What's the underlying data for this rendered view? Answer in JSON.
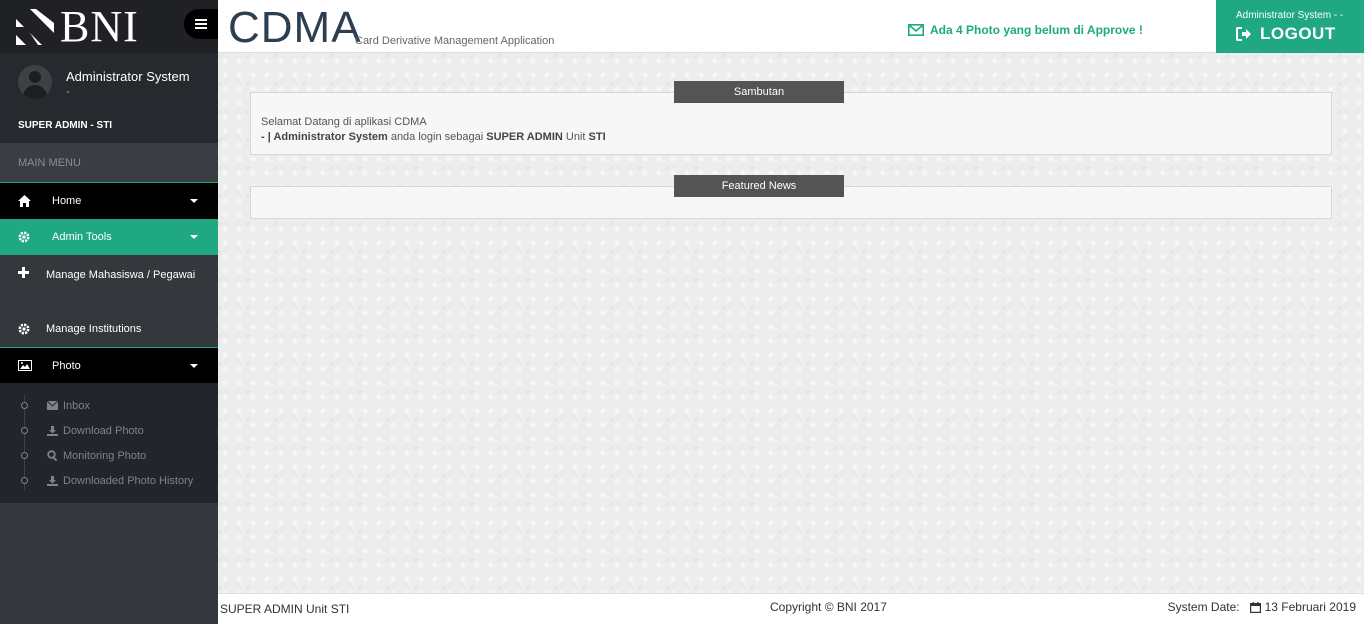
{
  "brand": {
    "logo_text": "BNI"
  },
  "user": {
    "name": "Administrator System",
    "sub": "-",
    "role": "SUPER ADMIN - STI"
  },
  "sidebar": {
    "main_menu_label": "MAIN MENU",
    "home_label": "Home",
    "admin_tools_label": "Admin Tools",
    "admin_sub": {
      "manage_mhs": "Manage Mahasiswa / Pegawai",
      "manage_inst": "Manage Institutions"
    },
    "photo_label": "Photo",
    "photo_sub": {
      "inbox": "Inbox",
      "download": "Download Photo",
      "monitoring": "Monitoring Photo",
      "history": "Downloaded Photo History"
    }
  },
  "header": {
    "title": "CDMA",
    "subtitle": "Card Derivative Management Application",
    "notification": "Ada 4 Photo yang belum di Approve !",
    "logout_user": "Administrator System - -",
    "logout_label": "LOGOUT"
  },
  "panels": {
    "sambutan": {
      "title": "Sambutan",
      "line1": "Selamat Datang di aplikasi CDMA",
      "prefix": "- | ",
      "user": "Administrator System",
      "mid": " anda login sebagai ",
      "role": "SUPER ADMIN",
      "unit_word": " Unit ",
      "unit": "STI"
    },
    "featured": {
      "title": "Featured News"
    }
  },
  "footer": {
    "left": "SUPER ADMIN Unit STI",
    "center": "Copyright © BNI 2017",
    "system_date_label": "System Date:",
    "system_date": "13 Februari 2019"
  },
  "colors": {
    "accent": "#1fa882",
    "dark": "#000000",
    "sidebar": "#34383d"
  }
}
